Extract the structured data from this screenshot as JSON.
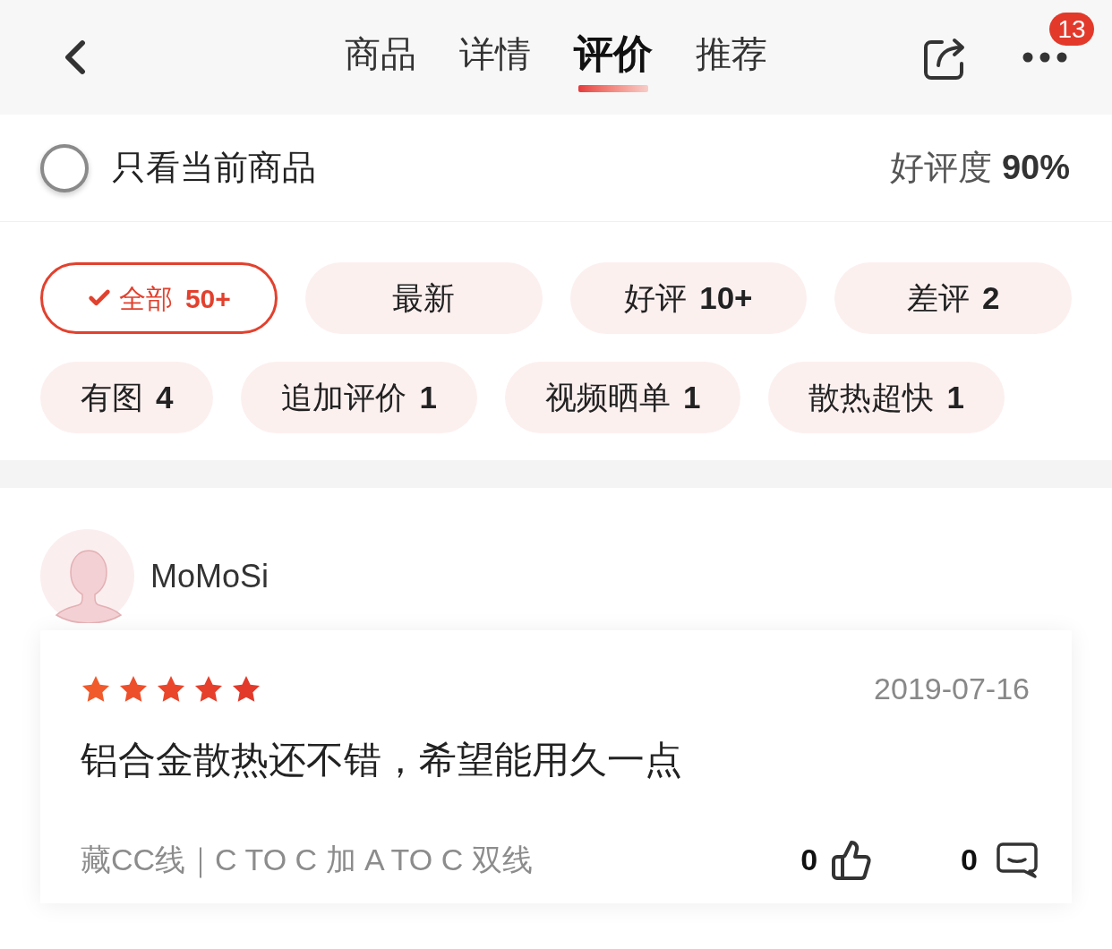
{
  "header": {
    "tabs": [
      {
        "label": "商品",
        "selected": false
      },
      {
        "label": "详情",
        "selected": false
      },
      {
        "label": "评价",
        "selected": true
      },
      {
        "label": "推荐",
        "selected": false
      }
    ],
    "badge": "13"
  },
  "filter_bar": {
    "only_current": {
      "label": "只看当前商品",
      "checked": false
    },
    "rating": {
      "label": "好评度",
      "value": "90%"
    }
  },
  "chips": [
    {
      "label": "全部",
      "count": "50+",
      "selected": true
    },
    {
      "label": "最新",
      "selected": false
    },
    {
      "label": "好评",
      "count": "10+",
      "selected": false
    },
    {
      "label": "差评",
      "count": "2",
      "selected": false
    },
    {
      "label": "有图",
      "count": "4",
      "selected": false
    },
    {
      "label": "追加评价",
      "count": "1",
      "selected": false
    },
    {
      "label": "视频晒单",
      "count": "1",
      "selected": false
    },
    {
      "label": "散热超快",
      "count": "1",
      "selected": false
    }
  ],
  "review": {
    "user": "MoMoSi",
    "stars": 5,
    "date": "2019-07-16",
    "text": "铝合金散热还不错，希望能用久一点",
    "spec": "藏CC线｜C TO C 加 A TO C 双线",
    "likes": "0",
    "comments": "0"
  }
}
